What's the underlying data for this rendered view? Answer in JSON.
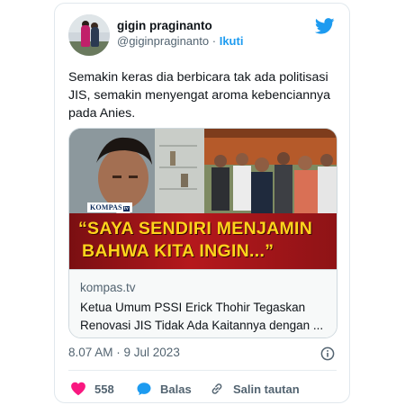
{
  "author": {
    "display_name": "gigin praginanto",
    "handle": "@giginpraginanto",
    "separator": "·",
    "follow_label": "Ikuti"
  },
  "tweet": {
    "text": "Semakin keras dia berbicara tak ada politisasi JIS, semakin menyengat aroma kebenciannya pada Anies."
  },
  "link_card": {
    "image_logo": "KOMPAS",
    "image_logo_suffix": "tv",
    "image_quote_line1": "“SAYA SENDIRI MENJAMIN",
    "image_quote_line2": "BAHWA KITA INGIN...”",
    "domain": "kompas.tv",
    "title_line1": "Ketua Umum PSSI Erick Thohir Tegaskan",
    "title_line2": "Renovasi JIS Tidak Ada Kaitannya dengan ..."
  },
  "meta": {
    "timestamp": "8.07 AM · 9 Jul 2023"
  },
  "actions": {
    "like_count": "558",
    "reply_label": "Balas",
    "copy_label": "Salin tautan"
  },
  "colors": {
    "accent": "#1d9bf0",
    "like": "#f91880",
    "quote_text": "#ffd41c",
    "quote_band": "#b5181c"
  },
  "icons": [
    "twitter-bird-icon",
    "info-icon",
    "heart-icon",
    "reply-bubble-icon",
    "link-icon"
  ]
}
